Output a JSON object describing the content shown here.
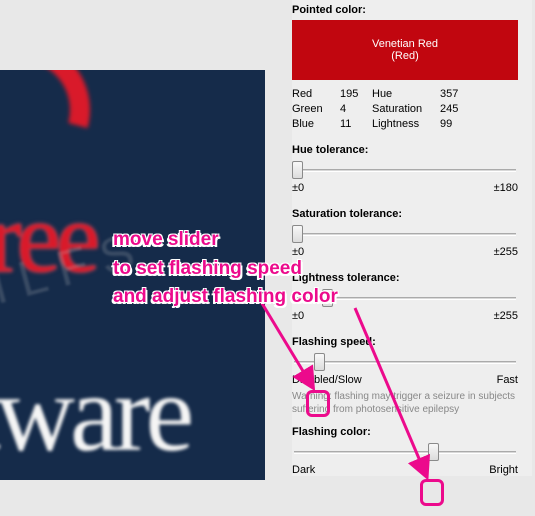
{
  "panel": {
    "pointed_color_label": "Pointed color:",
    "swatch_name": "Venetian Red",
    "swatch_group": "(Red)",
    "grid": {
      "red_label": "Red",
      "red_val": "195",
      "hue_label": "Hue",
      "hue_val": "357",
      "green_label": "Green",
      "green_val": "4",
      "sat_label": "Saturation",
      "sat_val": "245",
      "blue_label": "Blue",
      "blue_val": "11",
      "light_label": "Lightness",
      "light_val": "99"
    },
    "hue_tol": {
      "label": "Hue tolerance:",
      "min": "±0",
      "max": "±180"
    },
    "sat_tol": {
      "label": "Saturation tolerance:",
      "min": "±0",
      "max": "±255"
    },
    "light_tol": {
      "label": "Lightness tolerance:",
      "min": "±0",
      "max": "±255"
    },
    "flash_speed": {
      "label": "Flashing speed:",
      "min": "Disabled/Slow",
      "max": "Fast"
    },
    "warning": "Warning: flashing may trigger a seizure in subjects suffering from photosensitive epilepsy",
    "flash_color": {
      "label": "Flashing color:",
      "min": "Dark",
      "max": "Bright"
    }
  },
  "annotation": {
    "line1": "move slider",
    "line2": "to set flashing speed",
    "line3": "and adjust flashing color"
  },
  "logo": {
    "free": "free",
    "tware": "tware",
    "wm": "I L F S"
  }
}
